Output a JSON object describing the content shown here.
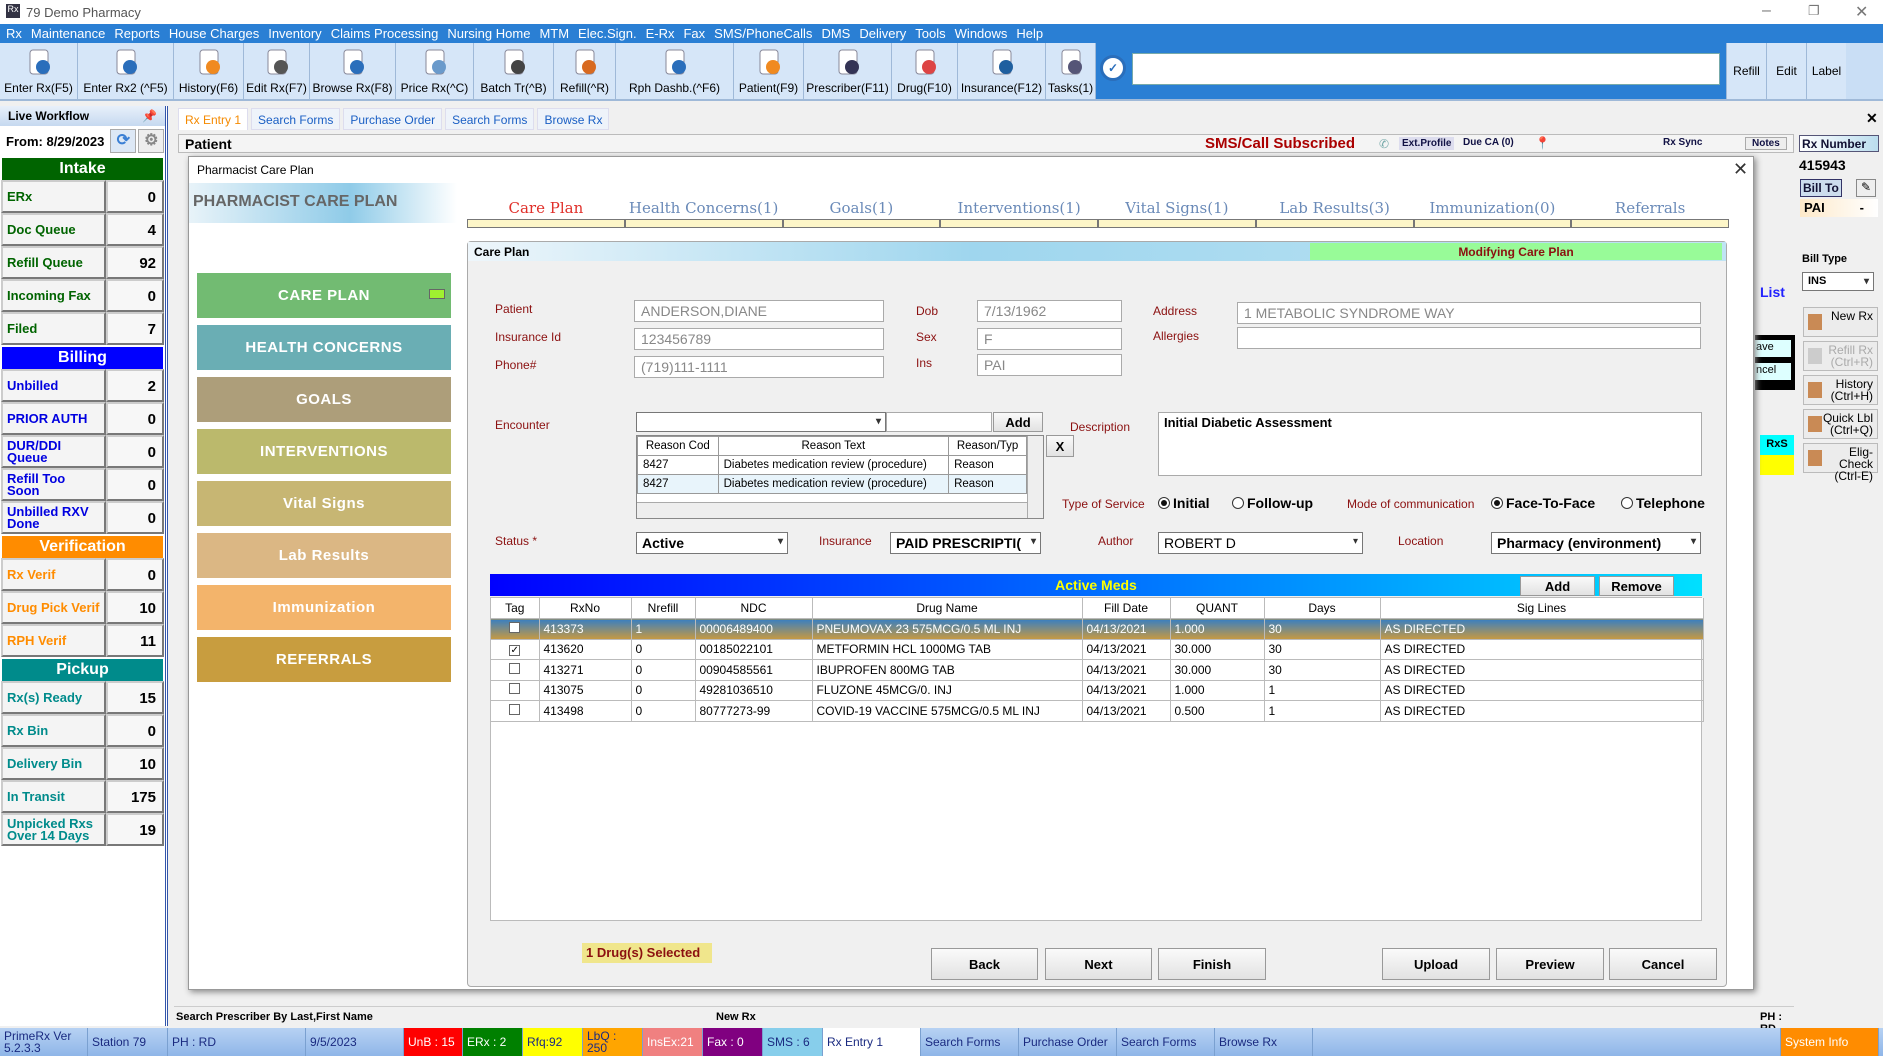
{
  "window": {
    "title": "79 Demo Pharmacy"
  },
  "menu": [
    "Rx",
    "Maintenance",
    "Reports",
    "House Charges",
    "Inventory",
    "Claims Processing",
    "Nursing Home",
    "MTM",
    "Elec.Sign.",
    "E-Rx",
    "Fax",
    "SMS/PhoneCalls",
    "DMS",
    "Delivery",
    "Tools",
    "Windows",
    "Help"
  ],
  "toolbar": {
    "buttons": [
      {
        "label": "Enter Rx(F5)",
        "icon": "enter-rx-icon",
        "w": 78
      },
      {
        "label": "Enter Rx2 (^F5)",
        "icon": "enter-rx2-icon",
        "w": 96
      },
      {
        "label": "History(F6)",
        "icon": "history-folder-icon",
        "w": 70
      },
      {
        "label": "Edit Rx(F7)",
        "icon": "edit-pencil-icon",
        "w": 66
      },
      {
        "label": "Browse Rx(F8)",
        "icon": "browse-magnifier-icon",
        "w": 86
      },
      {
        "label": "Price Rx(^C)",
        "icon": "price-tag-icon",
        "w": 78
      },
      {
        "label": "Batch Tr(^B)",
        "icon": "antenna-icon",
        "w": 80
      },
      {
        "label": "Refill(^R)",
        "icon": "refill-bottle-icon",
        "w": 62
      },
      {
        "label": "Rph Dashb.(^F6)",
        "icon": "dashboard-monitor-icon",
        "w": 118
      },
      {
        "label": "Patient(F9)",
        "icon": "patient-icon",
        "w": 70
      },
      {
        "label": "Prescriber(F11)",
        "icon": "prescriber-icon",
        "w": 88
      },
      {
        "label": "Drug(F10)",
        "icon": "pill-icon",
        "w": 66
      },
      {
        "label": "Insurance(F12)",
        "icon": "insurance-shield-icon",
        "w": 88
      },
      {
        "label": "Tasks(1)",
        "icon": "tasks-checklist-icon",
        "w": 50
      }
    ],
    "search_value": "",
    "right": [
      "Refill",
      "Edit",
      "Label"
    ]
  },
  "tabs": [
    {
      "label": "Rx Entry 1",
      "active": true
    },
    {
      "label": "Search Forms"
    },
    {
      "label": "Purchase Order"
    },
    {
      "label": "Search Forms"
    },
    {
      "label": "Browse Rx"
    }
  ],
  "sidebar": {
    "title": "Live Workflow",
    "from_label": "From:",
    "from_date": "8/29/2023",
    "sections": [
      {
        "name": "Intake",
        "color": "#006400",
        "text": "#006400",
        "items": [
          [
            "ERx",
            "0"
          ],
          [
            "Doc Queue",
            "4"
          ],
          [
            "Refill Queue",
            "92"
          ],
          [
            "Incoming Fax",
            "0"
          ],
          [
            "Filed",
            "7"
          ]
        ]
      },
      {
        "name": "Billing",
        "color": "#0000ff",
        "text": "#0000e0",
        "items": [
          [
            "Unbilled",
            "2"
          ],
          [
            "PRIOR AUTH",
            "0"
          ],
          [
            "DUR/DDI Queue",
            "0"
          ],
          [
            "Refill Too Soon",
            "0"
          ],
          [
            "Unbilled RXV Done",
            "0"
          ]
        ]
      },
      {
        "name": "Verification",
        "color": "#ff8c00",
        "text": "#ff8c00",
        "items": [
          [
            "Rx Verif",
            "0"
          ],
          [
            "Drug Pick Verif",
            "10"
          ],
          [
            "RPH Verif",
            "11"
          ]
        ]
      },
      {
        "name": "Pickup",
        "color": "#008b8b",
        "text": "#008b8b",
        "items": [
          [
            "Rx(s) Ready",
            "15"
          ],
          [
            "Rx Bin",
            "0"
          ],
          [
            "Delivery Bin",
            "10"
          ],
          [
            "In Transit",
            "175"
          ],
          [
            "Unpicked Rxs Over 14 Days",
            "19"
          ]
        ]
      }
    ]
  },
  "patient_header": {
    "title": "Patient",
    "sms": "SMS/Call Subscribed",
    "ext_profile": "Ext.Profile",
    "due_ca": "Due CA (0)",
    "rx_sync": "Rx Sync",
    "notes": "Notes"
  },
  "right_panel": {
    "rx_number_label": "Rx Number",
    "rx_number": "415943",
    "bill_to": "Bill To",
    "bill_to_value": "PAI",
    "bill_to_suffix": "-",
    "bill_type_label": "Bill Type",
    "bill_type": "INS",
    "list": "List",
    "save": "ave",
    "cancel": "ncel",
    "rxs": "RxS",
    "buttons": [
      {
        "label": "New Rx",
        "icon": "new-rx-icon"
      },
      {
        "label": "Refill Rx (Ctrl+R)",
        "icon": "refill-icon",
        "disabled": true
      },
      {
        "label": "History (Ctrl+H)",
        "icon": "history-scroll-icon"
      },
      {
        "label": "Quick Lbl (Ctrl+Q)",
        "icon": "printer-icon"
      },
      {
        "label": "Elig-Check (Ctrl-E)",
        "icon": "elig-check-icon"
      }
    ]
  },
  "modal": {
    "title": "Pharmacist Care Plan",
    "banner": "PHARMACIST CARE PLAN",
    "nav": [
      {
        "label": "CARE PLAN",
        "color": "#72bb72"
      },
      {
        "label": "HEALTH CONCERNS",
        "color": "#6aaeb4"
      },
      {
        "label": "GOALS",
        "color": "#ad9e7a"
      },
      {
        "label": "INTERVENTIONS",
        "color": "#bbb96c"
      },
      {
        "label": "Vital Signs",
        "color": "#c7b673"
      },
      {
        "label": "Lab Results",
        "color": "#dbb784"
      },
      {
        "label": "Immunization",
        "color": "#f3b46b"
      },
      {
        "label": "REFERRALS",
        "color": "#c89d3f"
      }
    ],
    "tabs": [
      "Care Plan",
      "Health Concerns(1)",
      "Goals(1)",
      "Interventions(1)",
      "Vital Signs(1)",
      "Lab Results(3)",
      "Immunization(0)",
      "Referrals"
    ],
    "panel_title": "Care Plan",
    "status_banner": "Modifying Care Plan",
    "form": {
      "patient_label": "Patient",
      "patient": "ANDERSON,DIANE",
      "insurance_id_label": "Insurance Id",
      "insurance_id": "123456789",
      "phone_label": "Phone#",
      "phone": "(719)111-1111",
      "dob_label": "Dob",
      "dob": "7/13/1962",
      "sex_label": "Sex",
      "sex": "F",
      "ins_label": "Ins",
      "ins": "PAI",
      "address_label": "Address",
      "address": "1 METABOLIC SYNDROME WAY",
      "allergies_label": "Allergies",
      "allergies": "",
      "encounter_label": "Encounter",
      "encounter_add": "Add",
      "remove_x": "X",
      "description_label": "Description",
      "description": "Initial Diabetic Assessment",
      "reason_columns": [
        "Reason Cod",
        "Reason Text",
        "Reason/Typ"
      ],
      "reasons": [
        [
          "8427",
          "Diabetes medication review (procedure)",
          "Reason"
        ],
        [
          "8427",
          "Diabetes medication review (procedure)",
          "Reason"
        ]
      ],
      "type_of_service_label": "Type of Service",
      "tos_options": [
        "Initial",
        "Follow-up"
      ],
      "tos_selected": "Initial",
      "mode_label": "Mode of communication",
      "mode_options": [
        "Face-To-Face",
        "Telephone"
      ],
      "mode_selected": "Face-To-Face",
      "status_label": "Status *",
      "status": "Active",
      "insurance_label": "Insurance",
      "insurance": "PAID PRESCRIPTI(",
      "author_label": "Author",
      "author": "ROBERT D",
      "location_label": "Location",
      "location": "Pharmacy (environment)"
    },
    "meds": {
      "title": "Active Meds",
      "add": "Add",
      "remove": "Remove",
      "columns": [
        "Tag",
        "RxNo",
        "Nrefill",
        "NDC",
        "Drug Name",
        "Fill Date",
        "QUANT",
        "Days",
        "Sig Lines"
      ],
      "rows": [
        {
          "tag": false,
          "cells": [
            "413373",
            "1",
            "00006489400",
            "PNEUMOVAX 23 575MCG/0.5 ML INJ",
            "04/13/2021",
            "1.000",
            "30",
            "AS DIRECTED"
          ],
          "highlight": true
        },
        {
          "tag": true,
          "cells": [
            "413620",
            "0",
            "00185022101",
            "METFORMIN HCL 1000MG TAB",
            "04/13/2021",
            "30.000",
            "30",
            "AS DIRECTED"
          ]
        },
        {
          "tag": false,
          "cells": [
            "413271",
            "0",
            "00904585561",
            "IBUPROFEN 800MG TAB",
            "04/13/2021",
            "30.000",
            "30",
            "AS DIRECTED"
          ]
        },
        {
          "tag": false,
          "cells": [
            "413075",
            "0",
            "49281036510",
            "FLUZONE 45MCG/0. INJ",
            "04/13/2021",
            "1.000",
            "1",
            "AS DIRECTED"
          ]
        },
        {
          "tag": false,
          "cells": [
            "413498",
            "0",
            "80777273-99",
            "COVID-19 VACCINE 575MCG/0.5 ML INJ",
            "04/13/2021",
            "0.500",
            "1",
            "AS DIRECTED"
          ]
        }
      ]
    },
    "selected_count": "1 Drug(s) Selected",
    "buttons": {
      "back": "Back",
      "next": "Next",
      "finish": "Finish",
      "upload": "Upload",
      "preview": "Preview",
      "cancel": "Cancel"
    }
  },
  "statusline": {
    "left": "Search Prescriber By Last,First Name",
    "mid": "New Rx",
    "right": "PH : RD"
  },
  "footer": [
    {
      "label": "PrimeRx Ver 5.2.3.3",
      "w": 88,
      "bg": ""
    },
    {
      "label": "Station 79",
      "w": 80,
      "bg": ""
    },
    {
      "label": "PH : RD",
      "w": 138,
      "bg": ""
    },
    {
      "label": "9/5/2023",
      "w": 98,
      "bg": ""
    },
    {
      "label": "UnB : 15",
      "w": 59,
      "bg": "#ff0000"
    },
    {
      "label": "ERx : 2",
      "w": 60,
      "bg": "#008000"
    },
    {
      "label": "Rfq:92",
      "w": 60,
      "bg": "#ffff00"
    },
    {
      "label": "LbQ : 250",
      "w": 60,
      "bg": "#ffa500"
    },
    {
      "label": "InsEx:21",
      "w": 60,
      "bg": "#f08080"
    },
    {
      "label": "Fax : 0",
      "w": 60,
      "bg": "#800080"
    },
    {
      "label": "SMS : 6",
      "w": 60,
      "bg": "#87ceeb"
    },
    {
      "label": "Rx Entry 1",
      "w": 98,
      "bg": "#ffffff"
    },
    {
      "label": "Search Forms",
      "w": 98,
      "bg": ""
    },
    {
      "label": "Purchase Order",
      "w": 98,
      "bg": ""
    },
    {
      "label": "Search Forms",
      "w": 98,
      "bg": ""
    },
    {
      "label": "Browse Rx",
      "w": 98,
      "bg": ""
    },
    {
      "label": "",
      "w": 468,
      "bg": ""
    },
    {
      "label": "System Info",
      "w": 98,
      "bg": "#ff8c00"
    }
  ]
}
